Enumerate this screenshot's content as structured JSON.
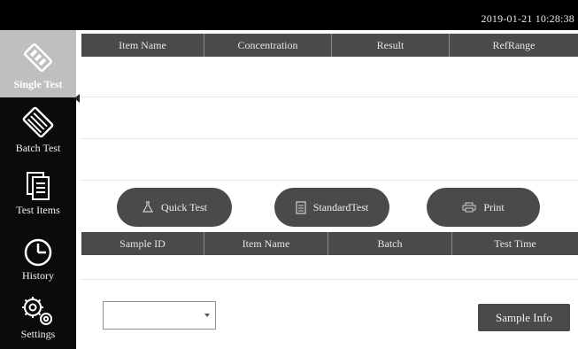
{
  "status_bar": {
    "datetime": "2019-01-21 10:28:38"
  },
  "sidebar": {
    "items": [
      {
        "label": "Single Test",
        "icon": "test-strip-icon",
        "active": true
      },
      {
        "label": "Batch Test",
        "icon": "test-strip-icon",
        "active": false
      },
      {
        "label": "Test Items",
        "icon": "document-icon",
        "active": false
      },
      {
        "label": "History",
        "icon": "clock-icon",
        "active": false
      },
      {
        "label": "Settings",
        "icon": "gear-icon",
        "active": false
      }
    ]
  },
  "result_table": {
    "columns": [
      "Item Name",
      "Concentration",
      "Result",
      "RefRange"
    ],
    "rows": []
  },
  "actions": {
    "quick_test": "Quick Test",
    "standard_test": "StandardTest",
    "print": "Print"
  },
  "sample_table": {
    "columns": [
      "Sample ID",
      "Item Name",
      "Batch",
      "Test Time"
    ],
    "rows": []
  },
  "sample_select": {
    "value": ""
  },
  "sample_info_button": "Sample Info",
  "colors": {
    "header_bg": "#4a4a4a",
    "sidebar_bg": "#0b0b0b",
    "active_nav_bg": "#bfbfbf"
  }
}
